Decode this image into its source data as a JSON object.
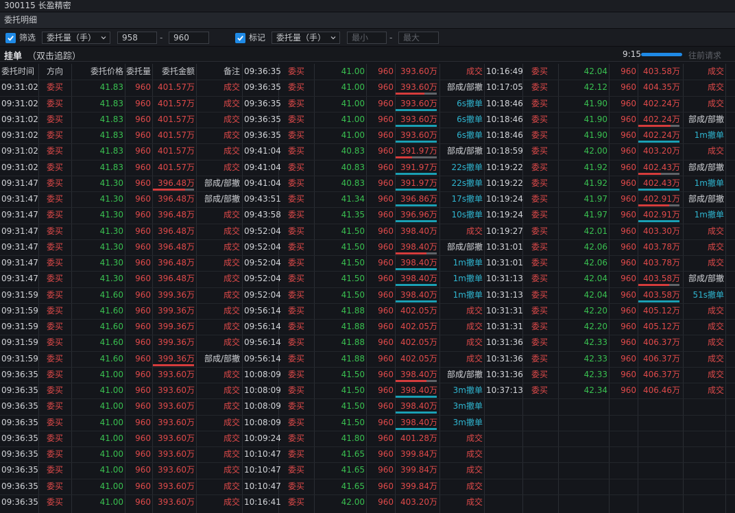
{
  "window": {
    "title": "300115 长盈精密"
  },
  "panel": {
    "title": "委托明细"
  },
  "filter": {
    "filter_label": "筛选",
    "filter_type": "委托量（手）",
    "min_value": "958",
    "max_value": "960",
    "dash": "-",
    "mark_label": "标记",
    "mark_type": "委托量（手）",
    "mark_min_placeholder": "最小",
    "mark_max_placeholder": "最大"
  },
  "section": {
    "title": "挂单",
    "subtitle": "（双击追踪）",
    "time": "9:15",
    "progress": 1.0,
    "more": "往前请求"
  },
  "colors": {
    "red": "#e04a4a",
    "green": "#39c050",
    "cyan": "#2fb5d0",
    "accent": "#1f8ae6",
    "teal_bar": "#1aa0b4",
    "red_bar": "#d63c3c",
    "gray_bar": "#606368"
  },
  "headers": [
    "委托时间",
    "方向",
    "委托价格",
    "委托量",
    "委托金额",
    "备注"
  ],
  "rows": [
    {
      "cols": [
        null,
        [
          "09:36:35",
          "委买",
          "41.00",
          "960",
          "393.60万",
          "成交",
          null,
          null
        ],
        [
          "10:16:49",
          "委买",
          "42.04",
          "960",
          "403.58万",
          "成交",
          null,
          null
        ]
      ]
    },
    {
      "cols": [
        [
          "09:31:02",
          "委买",
          "41.83",
          "960",
          "401.57万",
          "成交",
          null,
          null
        ],
        [
          "09:36:35",
          "委买",
          "41.00",
          "960",
          "393.60万",
          "部成/部撤",
          0.7,
          "part"
        ],
        [
          "10:17:05",
          "委买",
          "42.12",
          "960",
          "404.35万",
          "成交",
          null,
          null
        ]
      ]
    },
    {
      "cols": [
        [
          "09:31:02",
          "委买",
          "41.83",
          "960",
          "401.57万",
          "成交",
          null,
          null
        ],
        [
          "09:36:35",
          "委买",
          "41.00",
          "960",
          "393.60万",
          "6s撤单",
          1.0,
          "cancel"
        ],
        [
          "10:18:46",
          "委买",
          "41.90",
          "960",
          "402.24万",
          "成交",
          null,
          null
        ]
      ]
    },
    {
      "cols": [
        [
          "09:31:02",
          "委买",
          "41.83",
          "960",
          "401.57万",
          "成交",
          null,
          null
        ],
        [
          "09:36:35",
          "委买",
          "41.00",
          "960",
          "393.60万",
          "6s撤单",
          1.0,
          "cancel"
        ],
        [
          "10:18:46",
          "委买",
          "41.90",
          "960",
          "402.24万",
          "部成/部撤",
          0.78,
          "part"
        ]
      ]
    },
    {
      "cols": [
        [
          "09:31:02",
          "委买",
          "41.83",
          "960",
          "401.57万",
          "成交",
          null,
          null
        ],
        [
          "09:36:35",
          "委买",
          "41.00",
          "960",
          "393.60万",
          "6s撤单",
          1.0,
          "cancel"
        ],
        [
          "10:18:46",
          "委买",
          "41.90",
          "960",
          "402.24万",
          "1m撤单",
          1.0,
          "cancel"
        ]
      ]
    },
    {
      "cols": [
        [
          "09:31:02",
          "委买",
          "41.83",
          "960",
          "401.57万",
          "成交",
          null,
          null
        ],
        [
          "09:41:04",
          "委买",
          "40.83",
          "960",
          "391.97万",
          "部成/部撤",
          0.4,
          "part"
        ],
        [
          "10:18:59",
          "委买",
          "42.00",
          "960",
          "403.20万",
          "成交",
          null,
          null
        ]
      ]
    },
    {
      "cols": [
        [
          "09:31:02",
          "委买",
          "41.83",
          "960",
          "401.57万",
          "成交",
          null,
          null
        ],
        [
          "09:41:04",
          "委买",
          "40.83",
          "960",
          "391.97万",
          "22s撤单",
          1.0,
          "cancel"
        ],
        [
          "10:19:22",
          "委买",
          "41.92",
          "960",
          "402.43万",
          "部成/部撤",
          0.55,
          "part"
        ]
      ]
    },
    {
      "cols": [
        [
          "09:31:47",
          "委买",
          "41.30",
          "960",
          "396.48万",
          "部成/部撤",
          0.78,
          "part"
        ],
        [
          "09:41:04",
          "委买",
          "40.83",
          "960",
          "391.97万",
          "22s撤单",
          1.0,
          "cancel"
        ],
        [
          "10:19:22",
          "委买",
          "41.92",
          "960",
          "402.43万",
          "1m撤单",
          1.0,
          "cancel"
        ]
      ]
    },
    {
      "cols": [
        [
          "09:31:47",
          "委买",
          "41.30",
          "960",
          "396.48万",
          "部成/部撤",
          null,
          null
        ],
        [
          "09:43:51",
          "委买",
          "41.34",
          "960",
          "396.86万",
          "17s撤单",
          1.0,
          "cancel"
        ],
        [
          "10:19:24",
          "委买",
          "41.97",
          "960",
          "402.91万",
          "部成/部撤",
          0.75,
          "part"
        ]
      ]
    },
    {
      "cols": [
        [
          "09:31:47",
          "委买",
          "41.30",
          "960",
          "396.48万",
          "成交",
          null,
          null
        ],
        [
          "09:43:58",
          "委买",
          "41.35",
          "960",
          "396.96万",
          "10s撤单",
          1.0,
          "cancel"
        ],
        [
          "10:19:24",
          "委买",
          "41.97",
          "960",
          "402.91万",
          "1m撤单",
          1.0,
          "cancel"
        ]
      ]
    },
    {
      "cols": [
        [
          "09:31:47",
          "委买",
          "41.30",
          "960",
          "396.48万",
          "成交",
          null,
          null
        ],
        [
          "09:52:04",
          "委买",
          "41.50",
          "960",
          "398.40万",
          "成交",
          null,
          null
        ],
        [
          "10:19:27",
          "委买",
          "42.01",
          "960",
          "403.30万",
          "成交",
          null,
          null
        ]
      ]
    },
    {
      "cols": [
        [
          "09:31:47",
          "委买",
          "41.30",
          "960",
          "396.48万",
          "成交",
          null,
          null
        ],
        [
          "09:52:04",
          "委买",
          "41.50",
          "960",
          "398.40万",
          "部成/部撤",
          0.75,
          "part"
        ],
        [
          "10:31:01",
          "委买",
          "42.06",
          "960",
          "403.78万",
          "成交",
          null,
          null
        ]
      ]
    },
    {
      "cols": [
        [
          "09:31:47",
          "委买",
          "41.30",
          "960",
          "396.48万",
          "成交",
          null,
          null
        ],
        [
          "09:52:04",
          "委买",
          "41.50",
          "960",
          "398.40万",
          "1m撤单",
          1.0,
          "cancel"
        ],
        [
          "10:31:01",
          "委买",
          "42.06",
          "960",
          "403.78万",
          "成交",
          null,
          null
        ]
      ]
    },
    {
      "cols": [
        [
          "09:31:47",
          "委买",
          "41.30",
          "960",
          "396.48万",
          "成交",
          null,
          null
        ],
        [
          "09:52:04",
          "委买",
          "41.50",
          "960",
          "398.40万",
          "1m撤单",
          1.0,
          "cancel"
        ],
        [
          "10:31:13",
          "委买",
          "42.04",
          "960",
          "403.58万",
          "部成/部撤",
          0.75,
          "part"
        ]
      ]
    },
    {
      "cols": [
        [
          "09:31:59",
          "委买",
          "41.60",
          "960",
          "399.36万",
          "成交",
          null,
          null
        ],
        [
          "09:52:04",
          "委买",
          "41.50",
          "960",
          "398.40万",
          "1m撤单",
          1.0,
          "cancel"
        ],
        [
          "10:31:13",
          "委买",
          "42.04",
          "960",
          "403.58万",
          "51s撤单",
          1.0,
          "cancel"
        ]
      ]
    },
    {
      "cols": [
        [
          "09:31:59",
          "委买",
          "41.60",
          "960",
          "399.36万",
          "成交",
          null,
          null
        ],
        [
          "09:56:14",
          "委买",
          "41.88",
          "960",
          "402.05万",
          "成交",
          null,
          null
        ],
        [
          "10:31:31",
          "委买",
          "42.20",
          "960",
          "405.12万",
          "成交",
          null,
          null
        ]
      ]
    },
    {
      "cols": [
        [
          "09:31:59",
          "委买",
          "41.60",
          "960",
          "399.36万",
          "成交",
          null,
          null
        ],
        [
          "09:56:14",
          "委买",
          "41.88",
          "960",
          "402.05万",
          "成交",
          null,
          null
        ],
        [
          "10:31:31",
          "委买",
          "42.20",
          "960",
          "405.12万",
          "成交",
          null,
          null
        ]
      ]
    },
    {
      "cols": [
        [
          "09:31:59",
          "委买",
          "41.60",
          "960",
          "399.36万",
          "成交",
          null,
          null
        ],
        [
          "09:56:14",
          "委买",
          "41.88",
          "960",
          "402.05万",
          "成交",
          null,
          null
        ],
        [
          "10:31:36",
          "委买",
          "42.33",
          "960",
          "406.37万",
          "成交",
          null,
          null
        ]
      ]
    },
    {
      "cols": [
        [
          "09:31:59",
          "委买",
          "41.60",
          "960",
          "399.36万",
          "部成/部撤",
          1.0,
          "partred"
        ],
        [
          "09:56:14",
          "委买",
          "41.88",
          "960",
          "402.05万",
          "成交",
          null,
          null
        ],
        [
          "10:31:36",
          "委买",
          "42.33",
          "960",
          "406.37万",
          "成交",
          null,
          null
        ]
      ]
    },
    {
      "cols": [
        [
          "09:36:35",
          "委买",
          "41.00",
          "960",
          "393.60万",
          "成交",
          null,
          null
        ],
        [
          "10:08:09",
          "委买",
          "41.50",
          "960",
          "398.40万",
          "部成/部撤",
          0.75,
          "part"
        ],
        [
          "10:31:36",
          "委买",
          "42.33",
          "960",
          "406.37万",
          "成交",
          null,
          null
        ]
      ]
    },
    {
      "cols": [
        [
          "09:36:35",
          "委买",
          "41.00",
          "960",
          "393.60万",
          "成交",
          null,
          null
        ],
        [
          "10:08:09",
          "委买",
          "41.50",
          "960",
          "398.40万",
          "3m撤单",
          1.0,
          "cancel"
        ],
        [
          "10:37:13",
          "委买",
          "42.34",
          "960",
          "406.46万",
          "成交",
          null,
          null
        ]
      ]
    },
    {
      "cols": [
        [
          "09:36:35",
          "委买",
          "41.00",
          "960",
          "393.60万",
          "成交",
          null,
          null
        ],
        [
          "10:08:09",
          "委买",
          "41.50",
          "960",
          "398.40万",
          "3m撤单",
          1.0,
          "cancel"
        ],
        null
      ]
    },
    {
      "cols": [
        [
          "09:36:35",
          "委买",
          "41.00",
          "960",
          "393.60万",
          "成交",
          null,
          null
        ],
        [
          "10:08:09",
          "委买",
          "41.50",
          "960",
          "398.40万",
          "3m撤单",
          1.0,
          "cancel"
        ],
        null
      ]
    },
    {
      "cols": [
        [
          "09:36:35",
          "委买",
          "41.00",
          "960",
          "393.60万",
          "成交",
          null,
          null
        ],
        [
          "10:09:24",
          "委买",
          "41.80",
          "960",
          "401.28万",
          "成交",
          null,
          null
        ],
        null
      ]
    },
    {
      "cols": [
        [
          "09:36:35",
          "委买",
          "41.00",
          "960",
          "393.60万",
          "成交",
          null,
          null
        ],
        [
          "10:10:47",
          "委买",
          "41.65",
          "960",
          "399.84万",
          "成交",
          null,
          null
        ],
        null
      ]
    },
    {
      "cols": [
        [
          "09:36:35",
          "委买",
          "41.00",
          "960",
          "393.60万",
          "成交",
          null,
          null
        ],
        [
          "10:10:47",
          "委买",
          "41.65",
          "960",
          "399.84万",
          "成交",
          null,
          null
        ],
        null
      ]
    },
    {
      "cols": [
        [
          "09:36:35",
          "委买",
          "41.00",
          "960",
          "393.60万",
          "成交",
          null,
          null
        ],
        [
          "10:10:47",
          "委买",
          "41.65",
          "960",
          "399.84万",
          "成交",
          null,
          null
        ],
        null
      ]
    },
    {
      "cols": [
        [
          "09:36:35",
          "委买",
          "41.00",
          "960",
          "393.60万",
          "成交",
          null,
          null
        ],
        [
          "10:16:41",
          "委买",
          "42.00",
          "960",
          "403.20万",
          "成交",
          null,
          null
        ],
        null
      ]
    }
  ]
}
